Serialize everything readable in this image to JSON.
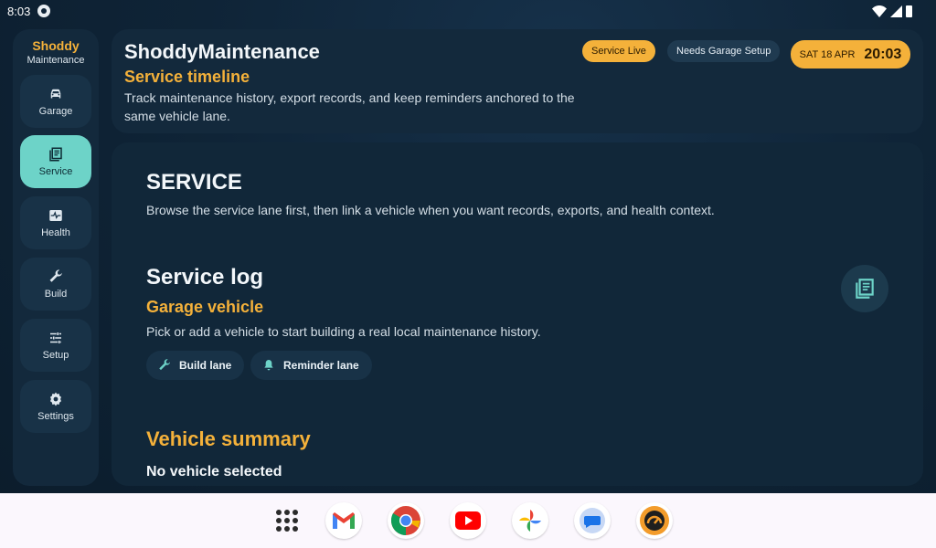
{
  "status_bar": {
    "time": "8:03"
  },
  "rail": {
    "app_name_line1": "Shoddy",
    "app_name_line2": "Maintenance",
    "items": [
      {
        "label": "Garage",
        "icon": "car-icon"
      },
      {
        "label": "Service",
        "icon": "service-log-icon",
        "active": true
      },
      {
        "label": "Health",
        "icon": "health-icon"
      },
      {
        "label": "Build",
        "icon": "wrench-icon"
      },
      {
        "label": "Setup",
        "icon": "sliders-icon"
      },
      {
        "label": "Settings",
        "icon": "gear-icon"
      }
    ]
  },
  "header": {
    "title": "ShoddyMaintenance",
    "subtitle": "Service timeline",
    "description": "Track maintenance history, export records, and keep reminders anchored to the same vehicle lane.",
    "chip_live": "Service Live",
    "chip_setup": "Needs Garage Setup",
    "date": "SAT 18 APR",
    "clock": "20:03"
  },
  "main": {
    "section_title": "SERVICE",
    "section_description": "Browse the service lane first, then link a vehicle when you want records, exports, and health context.",
    "log": {
      "title": "Service log",
      "subtitle": "Garage vehicle",
      "description": "Pick or add a vehicle to start building a real local maintenance history.",
      "build_lane": "Build lane",
      "reminder_lane": "Reminder lane"
    },
    "vehicle_summary": {
      "title": "Vehicle summary",
      "status": "No vehicle selected"
    }
  },
  "dock": {
    "apps": [
      "app-drawer-icon",
      "gmail-icon",
      "chrome-icon",
      "youtube-icon",
      "photos-icon",
      "messages-icon",
      "shoddy-app-icon"
    ]
  },
  "colors": {
    "accent": "#f4b13a",
    "active_nav": "#6dd3c8",
    "card": "#13293c"
  }
}
